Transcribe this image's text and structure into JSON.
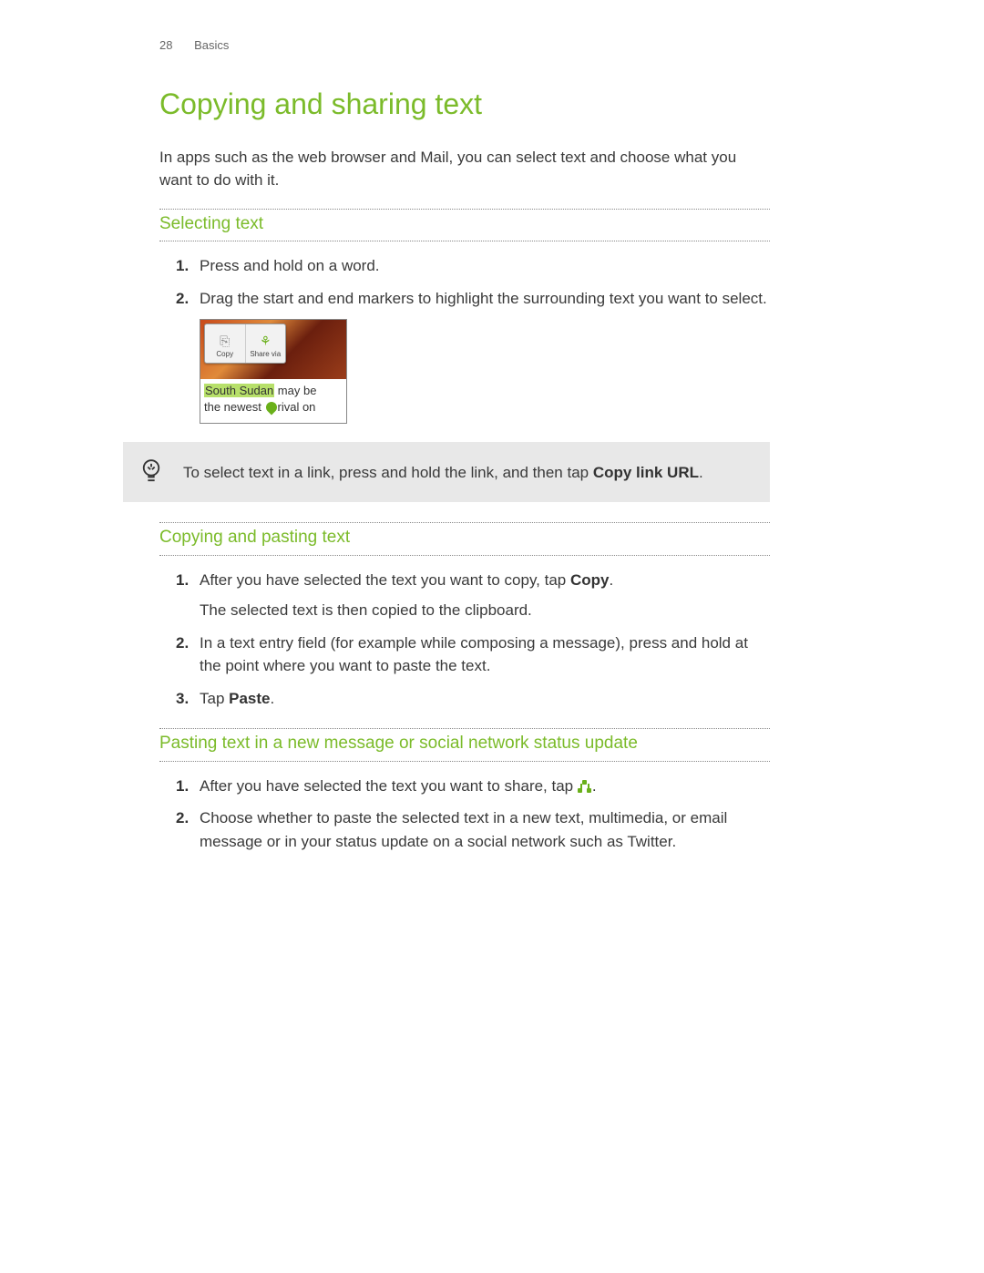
{
  "header": {
    "page_number": "28",
    "section": "Basics"
  },
  "title": "Copying and sharing text",
  "intro": "In apps such as the web browser and Mail, you can select text and choose what you want to do with it.",
  "sec1": {
    "heading": "Selecting text",
    "items": [
      {
        "num": "1.",
        "text": "Press and hold on a word."
      },
      {
        "num": "2.",
        "text": "Drag the start and end markers to highlight the surrounding text you want to select."
      }
    ],
    "screenshot": {
      "popup_copy": "Copy",
      "popup_share": "Share via",
      "highlighted": "South Sudan",
      "line1_rest": " may be",
      "line2a": "the newest ",
      "line2b": "rival on"
    }
  },
  "tip": {
    "pre": "To select text in a link, press and hold the link, and then tap ",
    "bold": "Copy link URL",
    "post": "."
  },
  "sec2": {
    "heading": "Copying and pasting text",
    "items": [
      {
        "num": "1.",
        "text_pre": "After you have selected the text you want to copy, tap ",
        "bold": "Copy",
        "text_post": ".",
        "para": "The selected text is then copied to the clipboard."
      },
      {
        "num": "2.",
        "text": "In a text entry field (for example while composing a message), press and hold at the point where you want to paste the text."
      },
      {
        "num": "3.",
        "text_pre": "Tap ",
        "bold": "Paste",
        "text_post": "."
      }
    ]
  },
  "sec3": {
    "heading": "Pasting text in a new message or social network status update",
    "items": [
      {
        "num": "1.",
        "text_pre": "After you have selected the text you want to share, tap ",
        "text_post": "."
      },
      {
        "num": "2.",
        "text": "Choose whether to paste the selected text in a new text, multimedia, or email message or in your status update on a social network such as Twitter."
      }
    ]
  }
}
